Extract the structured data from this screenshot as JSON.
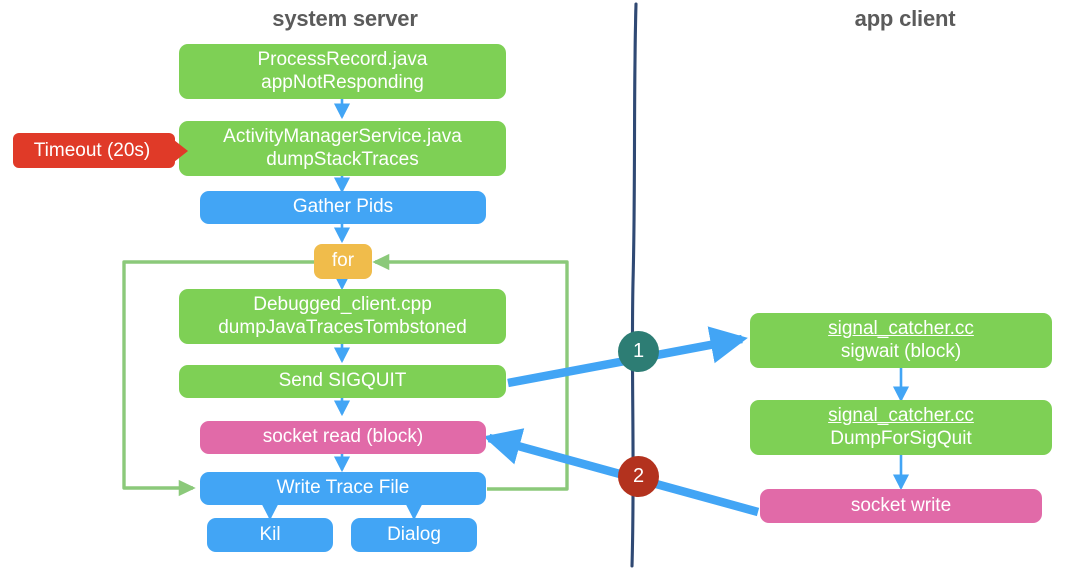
{
  "columns": [
    {
      "title": "system server"
    },
    {
      "title": "app client"
    }
  ],
  "colors": {
    "green": "#7ed055",
    "blue": "#42a5f5",
    "pink": "#e16aa8",
    "orange": "#f0bc4b",
    "red": "#e03a28",
    "loop_green": "#8bc97a",
    "marker_one": "#2d7d74",
    "marker_two": "#b3321e",
    "divider": "#1f3a66",
    "title_text": "#5b5b5b"
  },
  "annotations": {
    "timeout_label": "Timeout (20s)",
    "marker_one": "1",
    "marker_two": "2"
  },
  "server_nodes": [
    {
      "id": "process-record",
      "line1": "ProcessRecord.java",
      "line2": "appNotResponding",
      "color": "green"
    },
    {
      "id": "activity-manager-service",
      "line1": "ActivityManagerService.java",
      "line2": "dumpStackTraces",
      "color": "green"
    },
    {
      "id": "gather-pids",
      "line1": "Gather Pids",
      "line2": "",
      "color": "blue"
    },
    {
      "id": "for-loop",
      "line1": "for",
      "line2": "",
      "color": "orange"
    },
    {
      "id": "debugged-client",
      "line1": "Debugged_client.cpp",
      "line2": "dumpJavaTracesTombstoned",
      "color": "green"
    },
    {
      "id": "send-sigquit",
      "line1": "Send SIGQUIT",
      "line2": "",
      "color": "green"
    },
    {
      "id": "socket-read",
      "line1": "socket read  (block)",
      "line2": "",
      "color": "pink"
    },
    {
      "id": "write-trace-file",
      "line1": "Write Trace File",
      "line2": "",
      "color": "blue"
    },
    {
      "id": "kill",
      "line1": "Kil",
      "line2": "",
      "color": "blue"
    },
    {
      "id": "dialog",
      "line1": "Dialog",
      "line2": "",
      "color": "blue"
    }
  ],
  "client_nodes": [
    {
      "id": "signal-catcher-sigwait",
      "line1": "signal_catcher.cc",
      "line2": "sigwait  (block)",
      "color": "green",
      "underline_line1": true
    },
    {
      "id": "signal-catcher-dumpforsigquit",
      "line1": "signal_catcher.cc",
      "line2": "DumpForSigQuit",
      "color": "green",
      "underline_line1": true
    },
    {
      "id": "socket-write",
      "line1": "socket write",
      "line2": "",
      "color": "pink",
      "underline_line1": false
    }
  ]
}
